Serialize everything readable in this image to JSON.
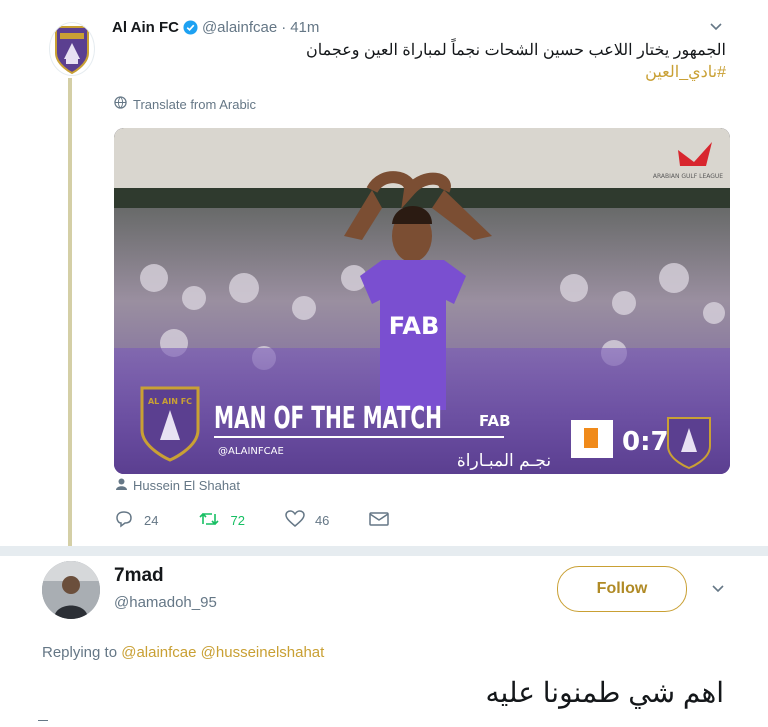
{
  "tweet": {
    "author_name": "Al Ain FC",
    "handle": "@alainfcae",
    "separator": "·",
    "time": "41m",
    "text_ar": "الجمهور يختار اللاعب حسين الشحات نجماً لمباراة العين وعجمان",
    "hashtag": "#نادي_العين",
    "translate_label": "Translate from Arabic",
    "media": {
      "headline": "MAN OF THE MATCH",
      "social_handle": "@ALAINFCAE",
      "kit_sponsor": "FAB",
      "arabic_caption": "نجـم المبـاراة",
      "score": "0:7",
      "crest_text": "AL AIN FC",
      "league_text": "ARABIAN GULF LEAGUE"
    },
    "tagged_user": "Hussein El Shahat",
    "stats": {
      "replies": "24",
      "retweets": "72",
      "likes": "46"
    },
    "colors": {
      "brand_gold": "#c9a034",
      "purple": "#5b3f90",
      "retweet_green": "#17bf63"
    }
  },
  "reply": {
    "author_name": "7mad",
    "handle": "@hamadoh_95",
    "follow_label": "Follow",
    "replying_to_label": "Replying to",
    "mention_1": "@alainfcae",
    "mention_2": "@husseinelshahat",
    "text_ar": "اهم شي طمنونا عليه"
  }
}
